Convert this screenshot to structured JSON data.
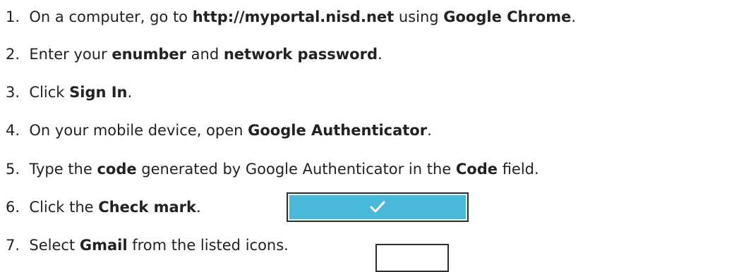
{
  "steps": [
    {
      "number": "1.",
      "t1": "On a computer, go to ",
      "b1": "http://myportal.nisd.net",
      "t2": " using ",
      "b2": "Google Chrome",
      "t3": "."
    },
    {
      "number": "2.",
      "t1": "Enter your ",
      "b1": "enumber",
      "t2": " and ",
      "b2": "network password",
      "t3": "."
    },
    {
      "number": "3.",
      "t1": "Click ",
      "b1": "Sign In",
      "t2": "."
    },
    {
      "number": "4.",
      "t1": "On your mobile device, open ",
      "b1": "Google Authenticator",
      "t2": "."
    },
    {
      "number": "5.",
      "t1": "Type the ",
      "b1": "code",
      "t2": " generated by Google Authenticator in the ",
      "b2": "Code",
      "t3": " field."
    },
    {
      "number": "6.",
      "t1": "Click the ",
      "b1": "Check mark",
      "t2": "."
    },
    {
      "number": "7.",
      "t1": "Select ",
      "b1": "Gmail",
      "t2": " from the listed icons."
    }
  ],
  "check_button": {
    "icon": "check-icon",
    "background": "#4ab8d8"
  },
  "gmail_thumbnail": {
    "icon": "gmail-icon"
  }
}
